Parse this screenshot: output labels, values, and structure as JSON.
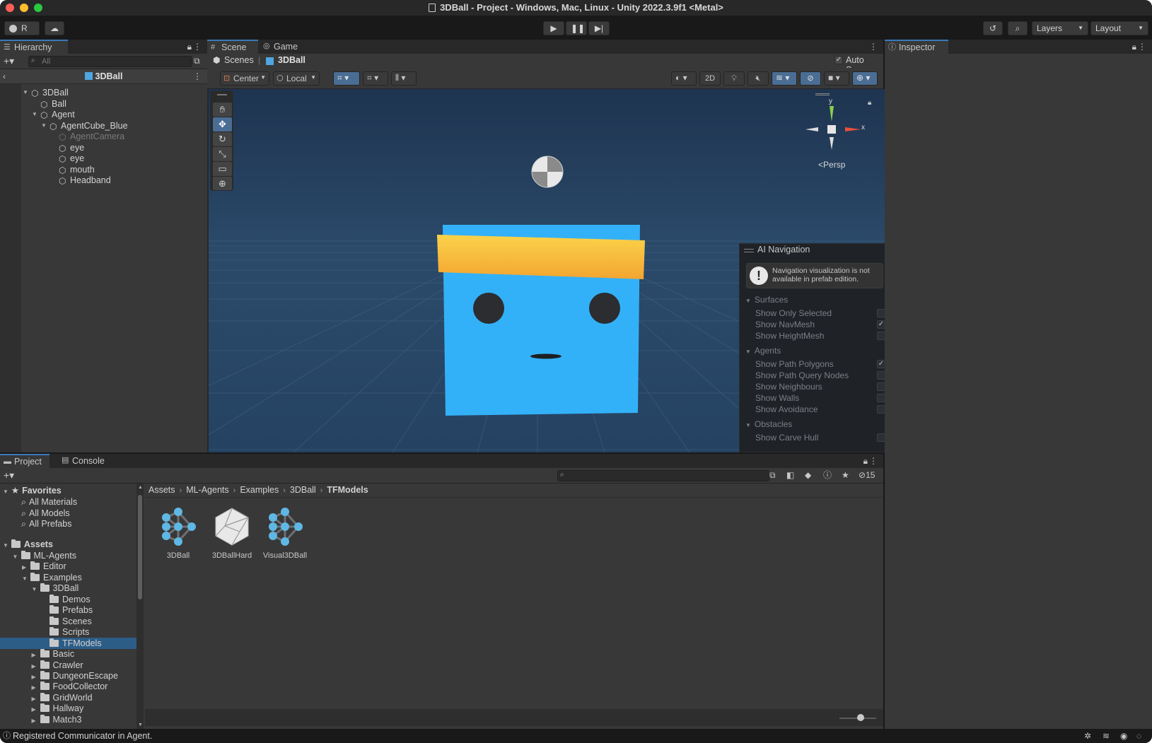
{
  "window": {
    "title": "3DBall - Project - Windows, Mac, Linux - Unity 2022.3.9f1 <Metal>"
  },
  "toolbar": {
    "account_label": "R",
    "layers_label": "Layers",
    "layout_label": "Layout",
    "play_icon": "play-icon",
    "pause_icon": "pause-icon",
    "step_icon": "step-icon"
  },
  "hierarchy": {
    "tab_label": "Hierarchy",
    "search_placeholder": "All",
    "scene_header": "3DBall",
    "items": [
      {
        "label": "3DBall",
        "depth": 0,
        "expanded": true
      },
      {
        "label": "Ball",
        "depth": 1
      },
      {
        "label": "Agent",
        "depth": 1,
        "expanded": true
      },
      {
        "label": "AgentCube_Blue",
        "depth": 2,
        "expanded": true
      },
      {
        "label": "AgentCamera",
        "depth": 3,
        "disabled": true
      },
      {
        "label": "eye",
        "depth": 3
      },
      {
        "label": "eye",
        "depth": 3
      },
      {
        "label": "mouth",
        "depth": 3
      },
      {
        "label": "Headband",
        "depth": 3
      }
    ]
  },
  "scene_view": {
    "tabs": [
      {
        "label": "Scene"
      },
      {
        "label": "Game"
      }
    ],
    "breadcrumb_scenes": "Scenes",
    "breadcrumb_current": "3DBall",
    "auto_save_label": "Auto Save",
    "auto_save_checked": true,
    "pivot_label": "Center",
    "space_label": "Local",
    "mode_2d_label": "2D",
    "persp_label": "Persp",
    "gizmo_y": "y",
    "gizmo_x": "x",
    "colors": {
      "cube": "#33b1f8",
      "headband": "#f8b93a",
      "sky": "#213a56"
    }
  },
  "ai_navigation": {
    "title": "AI Navigation",
    "warning": "Navigation visualization is not available in prefab edition.",
    "sections": [
      {
        "title": "Surfaces",
        "items": [
          {
            "label": "Show Only Selected",
            "checked": false
          },
          {
            "label": "Show NavMesh",
            "checked": true
          },
          {
            "label": "Show HeightMesh",
            "checked": false
          }
        ]
      },
      {
        "title": "Agents",
        "items": [
          {
            "label": "Show Path Polygons",
            "checked": true
          },
          {
            "label": "Show Path Query Nodes",
            "checked": false
          },
          {
            "label": "Show Neighbours",
            "checked": false
          },
          {
            "label": "Show Walls",
            "checked": false
          },
          {
            "label": "Show Avoidance",
            "checked": false
          }
        ]
      },
      {
        "title": "Obstacles",
        "items": [
          {
            "label": "Show Carve Hull",
            "checked": false
          }
        ]
      }
    ]
  },
  "inspector": {
    "tab_label": "Inspector"
  },
  "project": {
    "tabs": [
      {
        "label": "Project"
      },
      {
        "label": "Console"
      }
    ],
    "hidden_count": "15",
    "favorites_label": "Favorites",
    "favorites": [
      "All Materials",
      "All Models",
      "All Prefabs"
    ],
    "assets_label": "Assets",
    "tree": [
      {
        "label": "ML-Agents",
        "depth": 1,
        "expanded": true
      },
      {
        "label": "Editor",
        "depth": 2,
        "expanded": false
      },
      {
        "label": "Examples",
        "depth": 2,
        "expanded": true
      },
      {
        "label": "3DBall",
        "depth": 3,
        "expanded": true
      },
      {
        "label": "Demos",
        "depth": 4
      },
      {
        "label": "Prefabs",
        "depth": 4
      },
      {
        "label": "Scenes",
        "depth": 4
      },
      {
        "label": "Scripts",
        "depth": 4
      },
      {
        "label": "TFModels",
        "depth": 4,
        "selected": true
      },
      {
        "label": "Basic",
        "depth": 3,
        "expanded": false
      },
      {
        "label": "Crawler",
        "depth": 3,
        "expanded": false
      },
      {
        "label": "DungeonEscape",
        "depth": 3,
        "expanded": false
      },
      {
        "label": "FoodCollector",
        "depth": 3,
        "expanded": false
      },
      {
        "label": "GridWorld",
        "depth": 3,
        "expanded": false
      },
      {
        "label": "Hallway",
        "depth": 3,
        "expanded": false
      },
      {
        "label": "Match3",
        "depth": 3,
        "expanded": false
      }
    ],
    "breadcrumb": [
      "Assets",
      "ML-Agents",
      "Examples",
      "3DBall",
      "TFModels"
    ],
    "assets": [
      {
        "label": "3DBall",
        "icon": "neural-network-icon"
      },
      {
        "label": "3DBallHard",
        "icon": "model-icon"
      },
      {
        "label": "Visual3DBall",
        "icon": "neural-network-icon"
      }
    ]
  },
  "status_bar": {
    "message": "Registered Communicator in Agent."
  }
}
